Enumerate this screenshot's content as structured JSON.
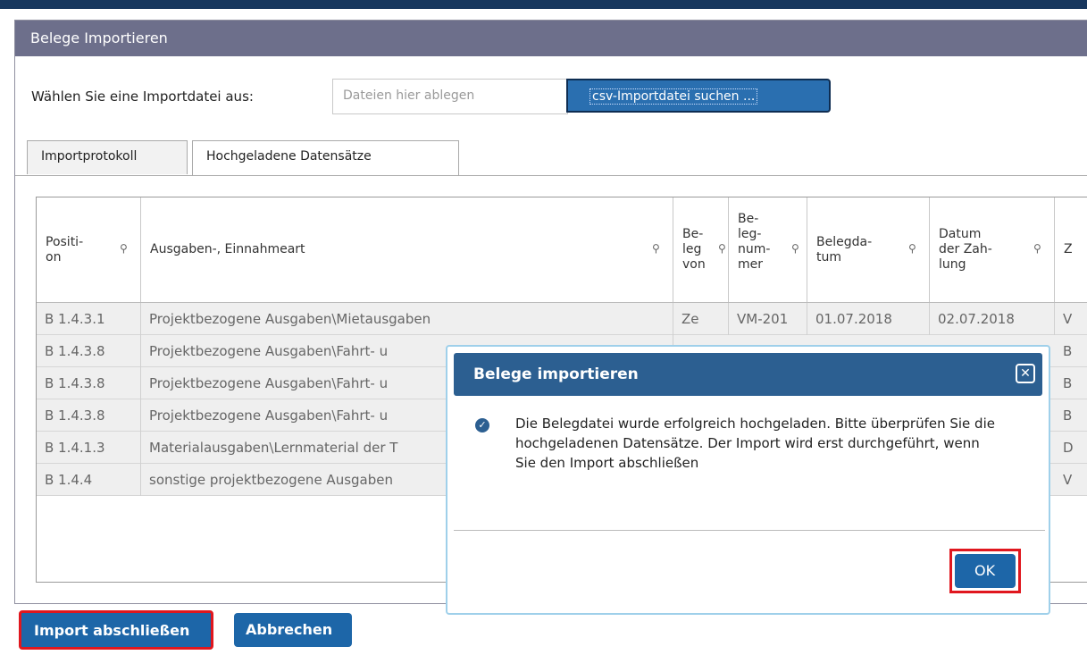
{
  "window": {
    "title": "Belege Importieren"
  },
  "file_select": {
    "label": "Wählen Sie eine Importdatei aus:",
    "dropzone_placeholder": "Dateien hier ablegen",
    "search_button": "csv-Importdatei suchen ..."
  },
  "tabs": [
    {
      "label": "Importprotokoll",
      "active": false
    },
    {
      "label": "Hochgeladene Datensätze",
      "active": true
    }
  ],
  "table": {
    "headers": {
      "position": "Positi-\non",
      "art": "Ausgaben-, Einnahmeart",
      "beleg_von": "Be-\nleg\nvon",
      "belegnummer": "Be-\nleg-\nnum-\nmer",
      "belegdatum": "Belegda-\ntum",
      "datum_zahlung": "Datum\nder Zah-\nlung",
      "z": "Z"
    },
    "rows": [
      {
        "position": "B 1.4.3.1",
        "art": "Projektbezogene Ausgaben\\Mietausgaben",
        "beleg_von": "Ze",
        "belegnummer": "VM-201",
        "belegdatum": "01.07.2018",
        "datum_zahlung": "02.07.2018",
        "z": "V"
      },
      {
        "position": "B 1.4.3.8",
        "art": "Projektbezogene Ausgaben\\Fahrt- u",
        "z": "B"
      },
      {
        "position": "B 1.4.3.8",
        "art": "Projektbezogene Ausgaben\\Fahrt- u",
        "z": "B"
      },
      {
        "position": "B 1.4.3.8",
        "art": "Projektbezogene Ausgaben\\Fahrt- u",
        "z": "B"
      },
      {
        "position": "B 1.4.1.3",
        "art": "Materialausgaben\\Lernmaterial der T",
        "z": "D"
      },
      {
        "position": "B 1.4.4",
        "art": "sonstige projektbezogene Ausgaben",
        "z": "V"
      }
    ]
  },
  "footer": {
    "finish_button": "Import abschließen",
    "cancel_button": "Abbrechen"
  },
  "dialog": {
    "title": "Belege importieren",
    "message": "Die Belegdatei wurde erfolgreich hochgeladen. Bitte überprüfen Sie die hochgeladenen Datensätze. Der Import wird erst durchgeführt, wenn Sie den Import abschließen",
    "ok_button": "OK"
  },
  "colors": {
    "titlebar": "#6d6f8b",
    "button": "#1d66a8",
    "dialog_header": "#2c5f91",
    "highlight": "#e0171e"
  }
}
